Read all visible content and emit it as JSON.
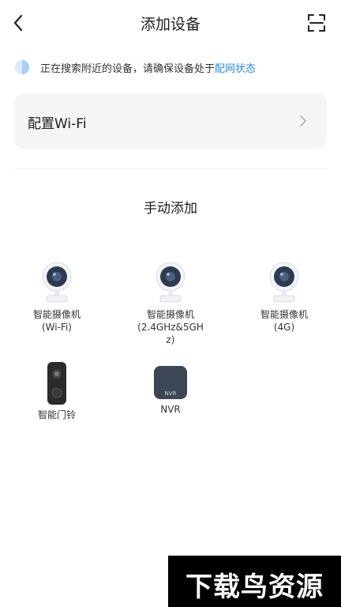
{
  "header": {
    "title": "添加设备"
  },
  "search_hint": {
    "text": "正在搜索附近的设备，请确保设备处于",
    "link": "配网状态"
  },
  "wifi_config": {
    "label": "配置Wi-Fi"
  },
  "manual": {
    "title": "手动添加",
    "devices": [
      {
        "name": "智能摄像机",
        "sub1": "(Wi-Fi)",
        "sub2": "",
        "icon": "camera-icon"
      },
      {
        "name": "智能摄像机",
        "sub1": "(2.4GHz&5GH",
        "sub2": "z)",
        "icon": "camera-icon"
      },
      {
        "name": "智能摄像机",
        "sub1": "(4G)",
        "sub2": "",
        "icon": "camera-icon"
      },
      {
        "name": "智能门铃",
        "sub1": "",
        "sub2": "",
        "icon": "doorbell-icon"
      },
      {
        "name": "NVR",
        "sub1": "",
        "sub2": "",
        "icon": "nvr-icon",
        "icon_text": "NVR"
      }
    ]
  },
  "watermark": {
    "text": "下载鸟资源"
  },
  "colors": {
    "link": "#2a8ae0",
    "card_bg": "#f5f5f5",
    "camera_lens": "#2e3a4f"
  }
}
